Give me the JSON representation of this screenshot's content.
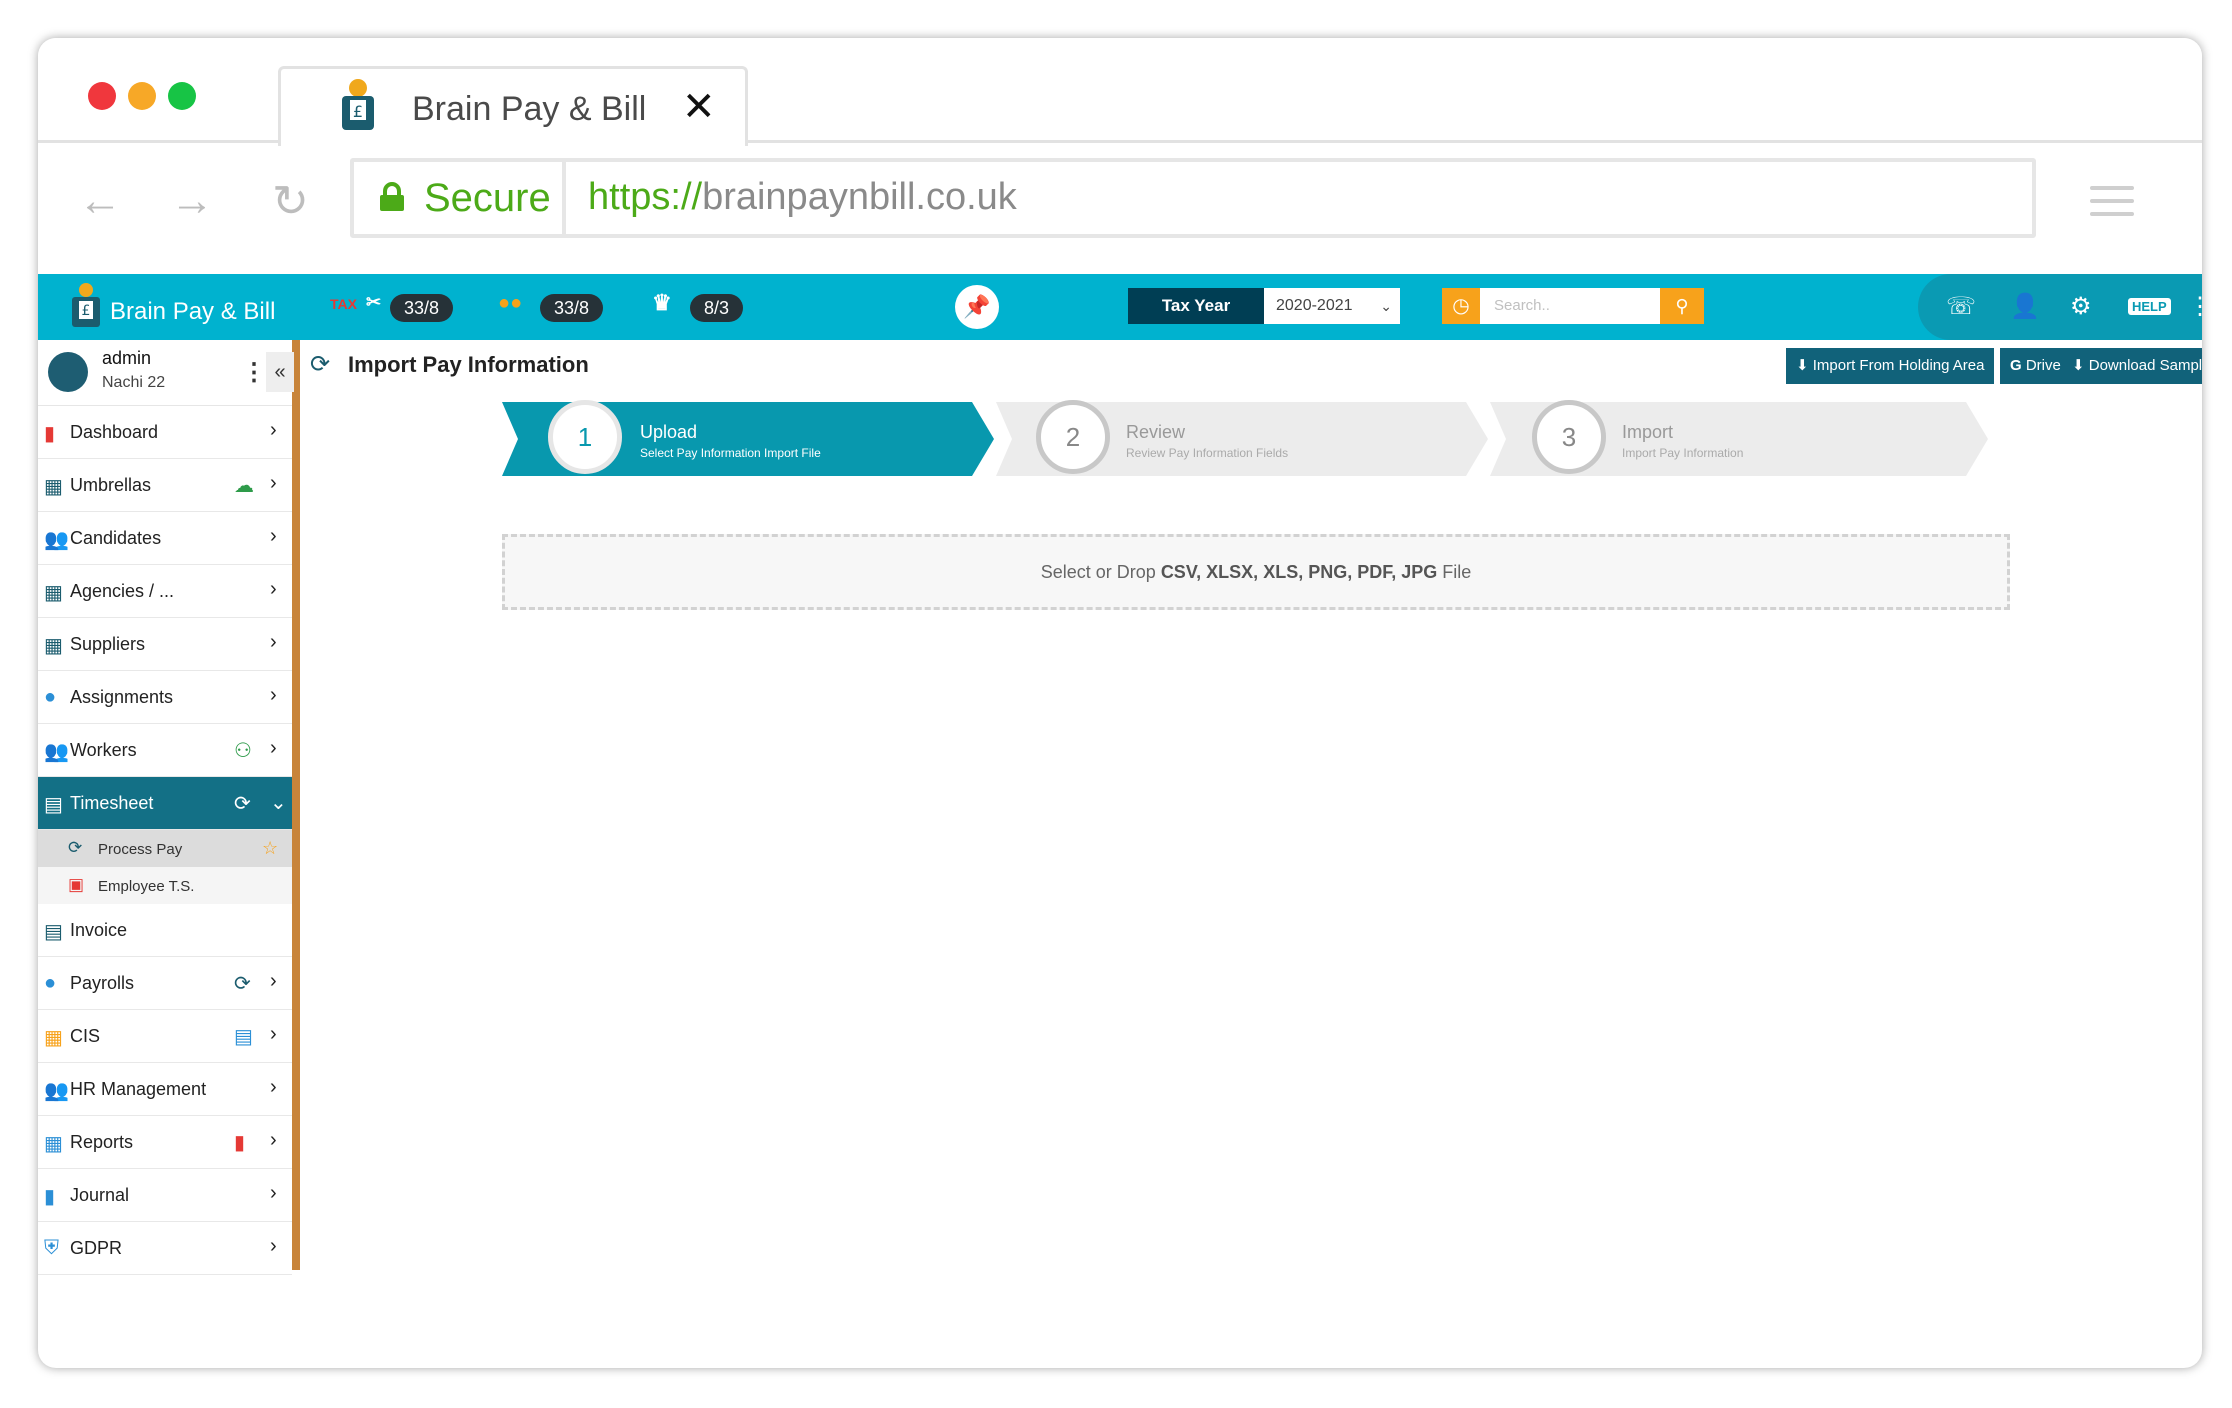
{
  "browser": {
    "tab_title": "Brain Pay & Bill",
    "tab_close": "✕",
    "secure_label": "Secure",
    "url_scheme": "https://",
    "url_host": "brainpaynbill.co.uk"
  },
  "header": {
    "app_name": "Brain Pay & Bill",
    "metrics": [
      {
        "icon": "tax-icon",
        "label": "TAX",
        "value": "33/8"
      },
      {
        "icon": "coins-icon",
        "value": "33/8"
      },
      {
        "icon": "crown-icon",
        "value": "8/3"
      }
    ],
    "tax_year_label": "Tax Year",
    "tax_year_value": "2020-2021",
    "search_placeholder": "Search..",
    "colors": {
      "primary": "#00b2cf",
      "dark": "#003e54",
      "accent": "#f7a21b",
      "sidebar_active": "#137086"
    }
  },
  "user": {
    "name": "admin",
    "company": "Nachi 22"
  },
  "sidebar": {
    "items": [
      {
        "label": "Dashboard",
        "icon": "chart-icon"
      },
      {
        "label": "Umbrellas",
        "icon": "building-icon",
        "extra": "cloud-upload-icon"
      },
      {
        "label": "Candidates",
        "icon": "candidates-icon"
      },
      {
        "label": "Agencies / ...",
        "icon": "agency-icon"
      },
      {
        "label": "Suppliers",
        "icon": "supplier-icon"
      },
      {
        "label": "Assignments",
        "icon": "assignment-icon"
      },
      {
        "label": "Workers",
        "icon": "workers-icon",
        "extra": "add-user-icon"
      },
      {
        "label": "Timesheet",
        "icon": "timesheet-icon",
        "extra": "pay-cycle-icon"
      },
      {
        "label": "Invoice",
        "icon": "invoice-icon"
      },
      {
        "label": "Payrolls",
        "icon": "payroll-icon",
        "extra": "pay-cycle-icon"
      },
      {
        "label": "CIS",
        "icon": "cis-icon",
        "extra": "document-icon"
      },
      {
        "label": "HR Management",
        "icon": "hr-icon"
      },
      {
        "label": "Reports",
        "icon": "reports-icon",
        "extra": "bar-chart-icon"
      },
      {
        "label": "Journal",
        "icon": "journal-icon"
      },
      {
        "label": "GDPR",
        "icon": "shield-icon"
      }
    ],
    "timesheet_sub": [
      {
        "label": "Process Pay"
      },
      {
        "label": "Employee T.S."
      }
    ]
  },
  "main": {
    "title": "Import Pay Information",
    "buttons": {
      "import_holding": "Import From Holding Area",
      "drive": "Drive",
      "download_sample": "Download Sample"
    },
    "steps": [
      {
        "number": "1",
        "title": "Upload",
        "subtitle": "Select Pay Information Import File"
      },
      {
        "number": "2",
        "title": "Review",
        "subtitle": "Review Pay Information Fields"
      },
      {
        "number": "3",
        "title": "Import",
        "subtitle": "Import Pay Information"
      }
    ],
    "dropzone": {
      "prefix": "Select or Drop",
      "formats": "CSV, XLSX, XLS, PNG, PDF, JPG",
      "suffix": "File"
    }
  }
}
